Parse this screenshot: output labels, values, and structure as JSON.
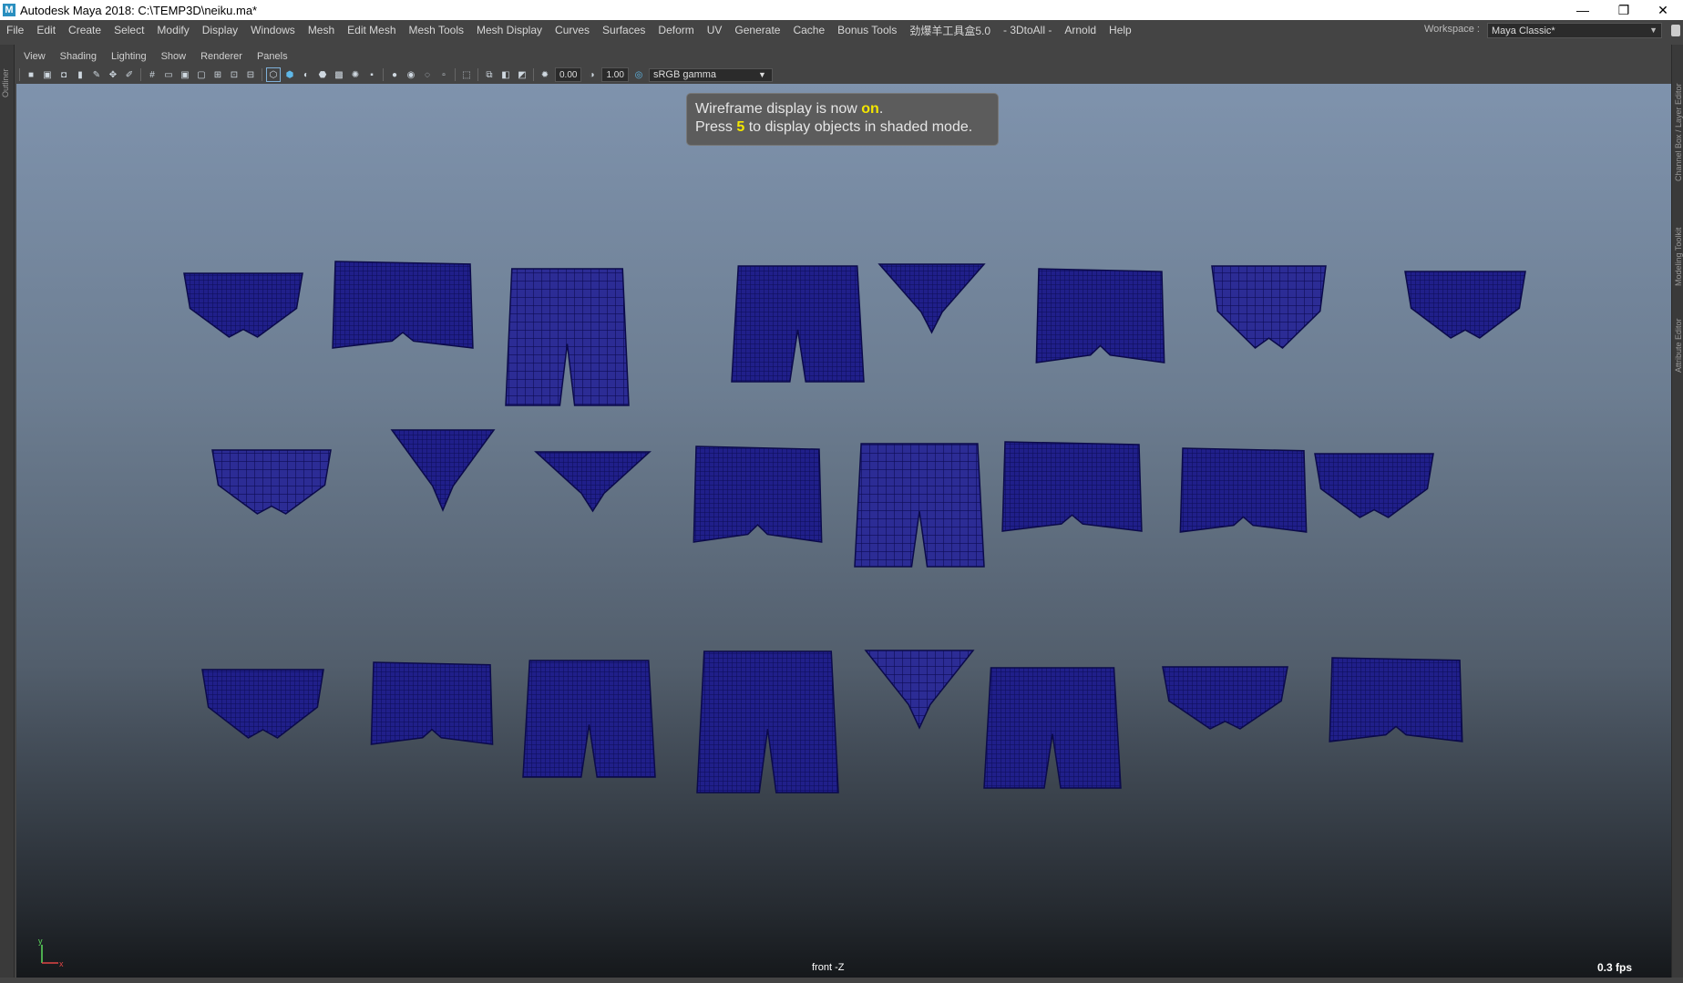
{
  "window": {
    "title": "Autodesk Maya 2018: C:\\TEMP3D\\neiku.ma*",
    "app_icon": "M",
    "controls": [
      "—",
      "❐",
      "✕"
    ]
  },
  "menubar": {
    "items": [
      "File",
      "Edit",
      "Create",
      "Select",
      "Modify",
      "Display",
      "Windows",
      "Mesh",
      "Edit Mesh",
      "Mesh Tools",
      "Mesh Display",
      "Curves",
      "Surfaces",
      "Deform",
      "UV",
      "Generate",
      "Cache",
      "Bonus Tools",
      "劲爆羊工具盒5.0",
      "- 3DtoAll -",
      "Arnold",
      "Help"
    ],
    "workspace_label": "Workspace :",
    "workspace_value": "Maya Classic*"
  },
  "side_panels": {
    "left": "Outliner",
    "right": [
      "Channel Box / Layer Editor",
      "Modeling Toolkit",
      "Attribute Editor"
    ]
  },
  "panel_menu": [
    "View",
    "Shading",
    "Lighting",
    "Show",
    "Renderer",
    "Panels"
  ],
  "toolbar": {
    "exposure": "0.00",
    "gamma": "1.00",
    "color_space": "sRGB gamma"
  },
  "viewport": {
    "hud_line1_prefix": "Wireframe display is now ",
    "hud_line1_value": "on",
    "hud_line1_suffix": ".",
    "hud_line2_prefix": "Press ",
    "hud_line2_key": "5",
    "hud_line2_suffix": " to display objects in shaded mode.",
    "camera": "front -Z",
    "fps": "0.3 fps",
    "wire_color": "#1b1a7a",
    "axis_y": "y",
    "axis_x": "x"
  }
}
